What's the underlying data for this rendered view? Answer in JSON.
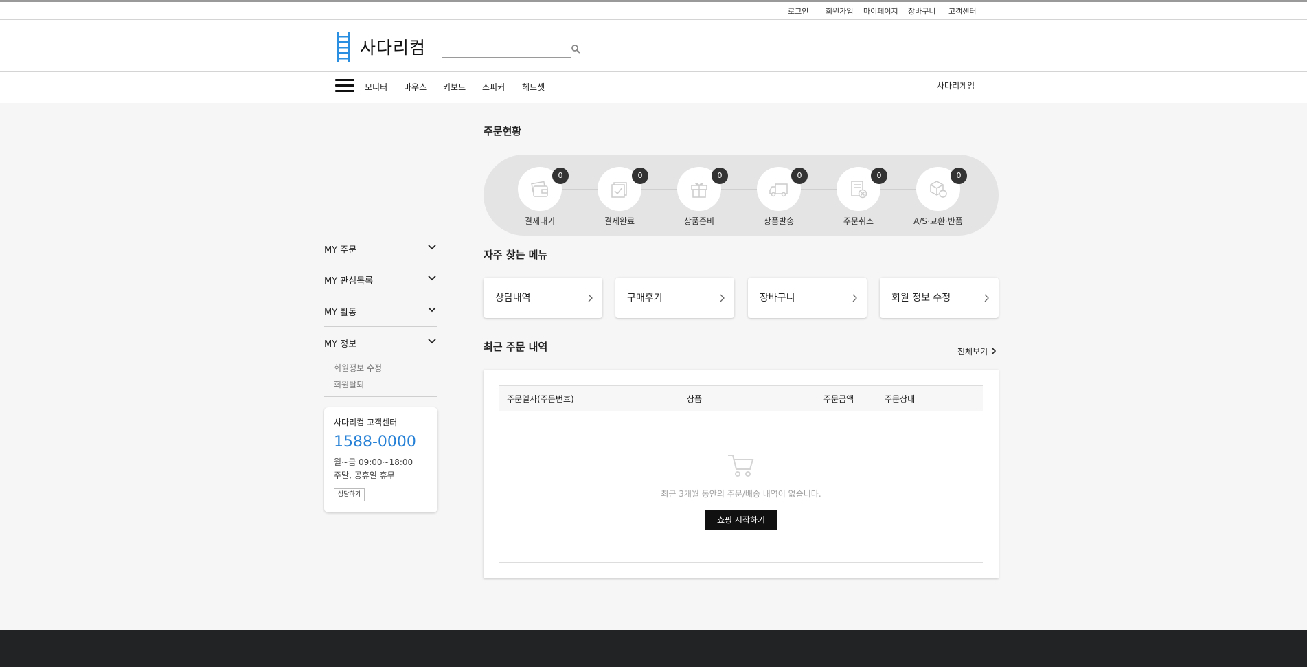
{
  "util_links": [
    "로그인",
    "회원가입",
    "마이페이지",
    "장바구니",
    "고객센터"
  ],
  "header": {
    "logo_text": "사다리컴",
    "search_value": "",
    "brand_color": "#2a8fe0"
  },
  "nav": {
    "categories": [
      "모니터",
      "마우스",
      "키보드",
      "스피커",
      "헤드셋"
    ],
    "right_link": "사다리게임"
  },
  "sidebar": {
    "items": [
      {
        "label": "MY 주문",
        "icon": "chevron-down-icon"
      },
      {
        "label": "MY 관심목록",
        "icon": "chevron-down-icon"
      },
      {
        "label": "MY 활동",
        "icon": "chevron-down-icon"
      },
      {
        "label": "MY 정보",
        "icon": "chevron-down-icon"
      }
    ],
    "sub_items": [
      "회원정보 수정",
      "회원탈퇴"
    ],
    "customer_center": {
      "title": "사다리컴 고객센터",
      "phone": "1588-0000",
      "hours": "월~금 09:00~18:00",
      "weekend": "주말, 공휴일 휴무",
      "button": "상담하기",
      "phone_color": "#2580d6"
    }
  },
  "order_status": {
    "title": "주문현황",
    "steps": [
      {
        "label": "결제대기",
        "count": "0",
        "icon": "wallet-icon"
      },
      {
        "label": "결제완료",
        "count": "0",
        "icon": "checkbox-icon"
      },
      {
        "label": "상품준비",
        "count": "0",
        "icon": "gift-icon"
      },
      {
        "label": "상품발송",
        "count": "0",
        "icon": "truck-icon"
      },
      {
        "label": "주문취소",
        "count": "0",
        "icon": "cancel-document-icon"
      },
      {
        "label": "A/S·교환·반품",
        "count": "0",
        "icon": "return-box-icon"
      }
    ]
  },
  "quick_menu": {
    "title": "자주 찾는 메뉴",
    "items": [
      "상담내역",
      "구매후기",
      "장바구니",
      "회원 정보 수정"
    ]
  },
  "recent_orders": {
    "title": "최근 주문 내역",
    "view_all": "전체보기",
    "columns": [
      "주문일자(주문번호)",
      "상품",
      "주문금액",
      "주문상태"
    ],
    "empty_text": "최근 3개월 동안의 주문/배송 내역이 없습니다.",
    "empty_icon": "shopping-cart-icon",
    "shop_button": "쇼핑 시작하기"
  }
}
